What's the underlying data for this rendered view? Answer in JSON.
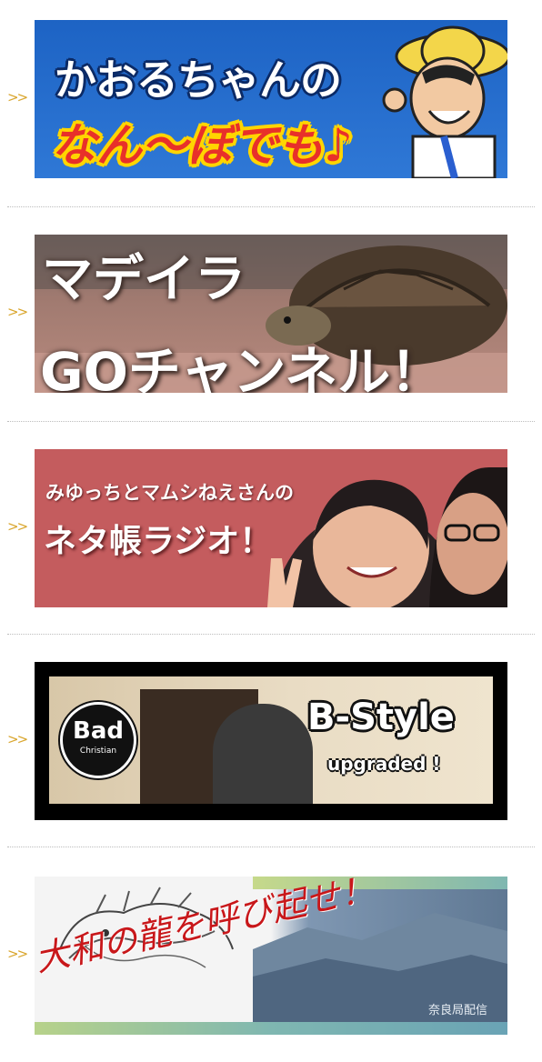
{
  "arrow_symbol": ">>",
  "banners": [
    {
      "line1": "かおるちゃんの",
      "line2": "なん〜ぼでも♪"
    },
    {
      "line1": "マデイラ",
      "line2": "GOチャンネル！"
    },
    {
      "line1": "みゆっちとマムシねえさんの",
      "line2": "ネタ帳ラジオ！"
    },
    {
      "logo_top": "Bad",
      "logo_bottom": "Christian",
      "title": "B-Style",
      "subtitle": "upgraded !"
    },
    {
      "title": "大和の龍を呼び起せ！",
      "mark": "奈良局配信"
    }
  ],
  "colors": {
    "arrow": "#d9a62e",
    "banner1_bg": "#1d63c4",
    "banner3_bg": "#c45c5e",
    "banner5_title": "#c8171a"
  },
  "icons": {
    "list_marker": "double-chevron-right"
  }
}
